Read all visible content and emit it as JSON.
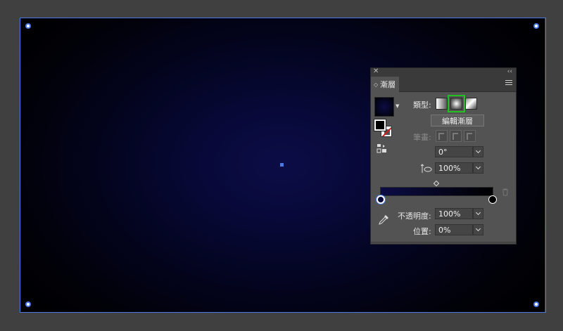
{
  "panel": {
    "tab_label": "漸層",
    "type_label": "類型:",
    "edit_gradient_label": "編輯漸層",
    "stroke_label": "筆畫:",
    "angle_value": "0°",
    "aspect_value": "100%",
    "opacity_label": "不透明度:",
    "opacity_value": "100%",
    "location_label": "位置:",
    "location_value": "0%",
    "selected_type": "radial"
  },
  "icons": {
    "close": "close-icon",
    "collapse": "collapse-icon",
    "menu": "menu-icon",
    "angle": "angle-icon",
    "aspect": "aspect-ratio-icon",
    "trash": "trash-icon",
    "eyedropper": "eyedropper-icon"
  },
  "colors": {
    "selection": "#4a78e6",
    "highlight": "#22c122",
    "gradient_start": "#0c0c46",
    "gradient_end": "#000000"
  }
}
